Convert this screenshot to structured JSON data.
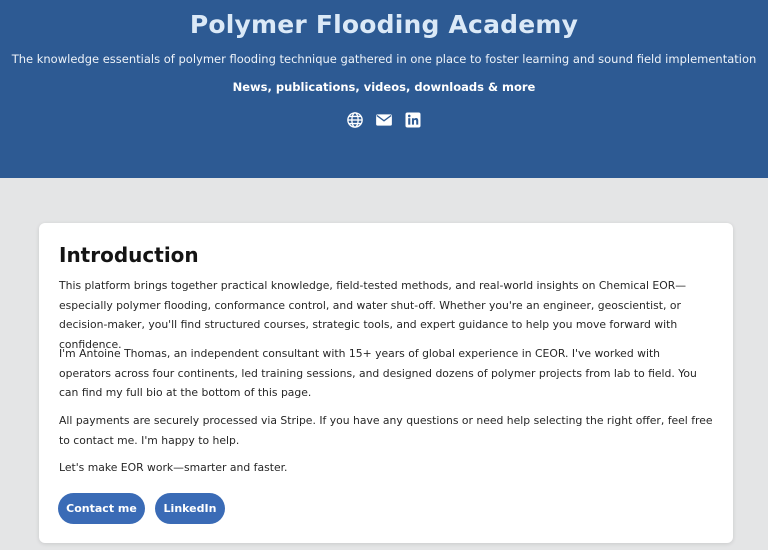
{
  "header": {
    "title": "Polymer Flooding Academy",
    "subtitle": "The knowledge essentials of polymer flooding technique gathered in one place to foster learning and sound field implementation",
    "tagline": "News, publications, videos, downloads & more",
    "icons": [
      "globe-icon",
      "mail-icon",
      "linkedin-icon"
    ],
    "background_color": "#2d5a93"
  },
  "intro": {
    "title": "Introduction",
    "paragraphs": [
      "This platform brings together practical knowledge, field-tested methods, and real-world insights on Chemical EOR—especially polymer flooding, conformance control, and water shut-off. Whether you're an engineer, geoscientist, or decision-maker, you'll find structured courses, strategic tools, and expert guidance to help you move forward with confidence.",
      "I'm Antoine Thomas, an independent consultant with 15+ years of global experience in CEOR. I've worked with operators across four continents, led training sessions, and designed dozens of polymer projects from lab to field. You can find my full bio at the bottom of this page.",
      "All payments are securely processed via Stripe. If you have any questions or need help selecting the right offer, feel free to contact me. I'm happy to help.",
      "Let's make EOR work—smarter and faster."
    ],
    "buttons": {
      "contact": "Contact me",
      "linkedin": "LinkedIn"
    },
    "button_color": "#3a6bb6"
  },
  "page_background": "#e4e5e6"
}
